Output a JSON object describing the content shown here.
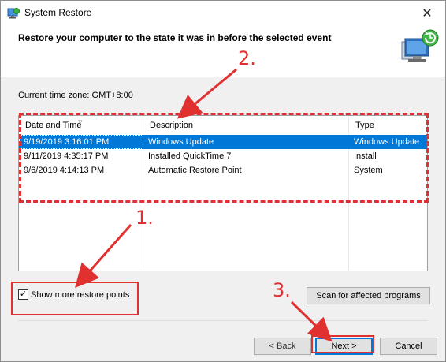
{
  "window": {
    "title": "System Restore",
    "close_glyph": "✕"
  },
  "header": {
    "title": "Restore your computer to the state it was in before the selected event"
  },
  "timezone_label": "Current time zone: GMT+8:00",
  "table": {
    "columns": [
      "Date and Time",
      "Description",
      "Type"
    ],
    "rows": [
      {
        "date": "9/19/2019 3:16:01 PM",
        "description": "Windows Update",
        "type": "Windows Update",
        "selected": true
      },
      {
        "date": "9/11/2019 4:35:17 PM",
        "description": "Installed QuickTime 7",
        "type": "Install",
        "selected": false
      },
      {
        "date": "9/6/2019 4:14:13 PM",
        "description": "Automatic Restore Point",
        "type": "System",
        "selected": false
      }
    ]
  },
  "show_more": {
    "label": "Show more restore points",
    "checked": true
  },
  "buttons": {
    "scan": "Scan for affected programs",
    "back": "< Back",
    "next": "Next >",
    "cancel": "Cancel"
  },
  "annotations": {
    "one": "1.",
    "two": "2.",
    "three": "3."
  },
  "colors": {
    "selection": "#0078d7",
    "annotation": "#e03030"
  }
}
